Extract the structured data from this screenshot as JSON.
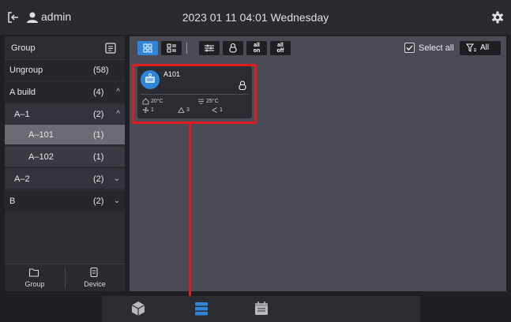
{
  "header": {
    "username": "admin",
    "datetime": "2023 01 11 04:01 Wednesday"
  },
  "sidebar": {
    "header_label": "Group",
    "items": [
      {
        "label": "Ungroup",
        "count": "(58)",
        "chevron": ""
      },
      {
        "label": "A build",
        "count": "(4)",
        "chevron": "^"
      },
      {
        "label": "A–1",
        "count": "(2)",
        "chevron": "^"
      },
      {
        "label": "A–101",
        "count": "(1)",
        "chevron": ""
      },
      {
        "label": "A–102",
        "count": "(1)",
        "chevron": ""
      },
      {
        "label": "A–2",
        "count": "(2)",
        "chevron": "⌄"
      },
      {
        "label": "B",
        "count": "(2)",
        "chevron": "⌄"
      }
    ],
    "footer_tabs": [
      {
        "label": "Group"
      },
      {
        "label": "Device"
      }
    ]
  },
  "toolbar": {
    "all_on_top": "all",
    "all_on_bottom": "on",
    "all_off_top": "all",
    "all_off_bottom": "off",
    "select_all_label": "Select all",
    "filter_label": "All"
  },
  "device_card": {
    "name": "A101",
    "indoor_temp": "20°C",
    "set_temp": "25°C",
    "fan": "1",
    "mode": "3",
    "swing": "1"
  },
  "colors": {
    "accent": "#2f86d8",
    "highlight": "#e11b22",
    "selected_row": "#6b6c73"
  }
}
